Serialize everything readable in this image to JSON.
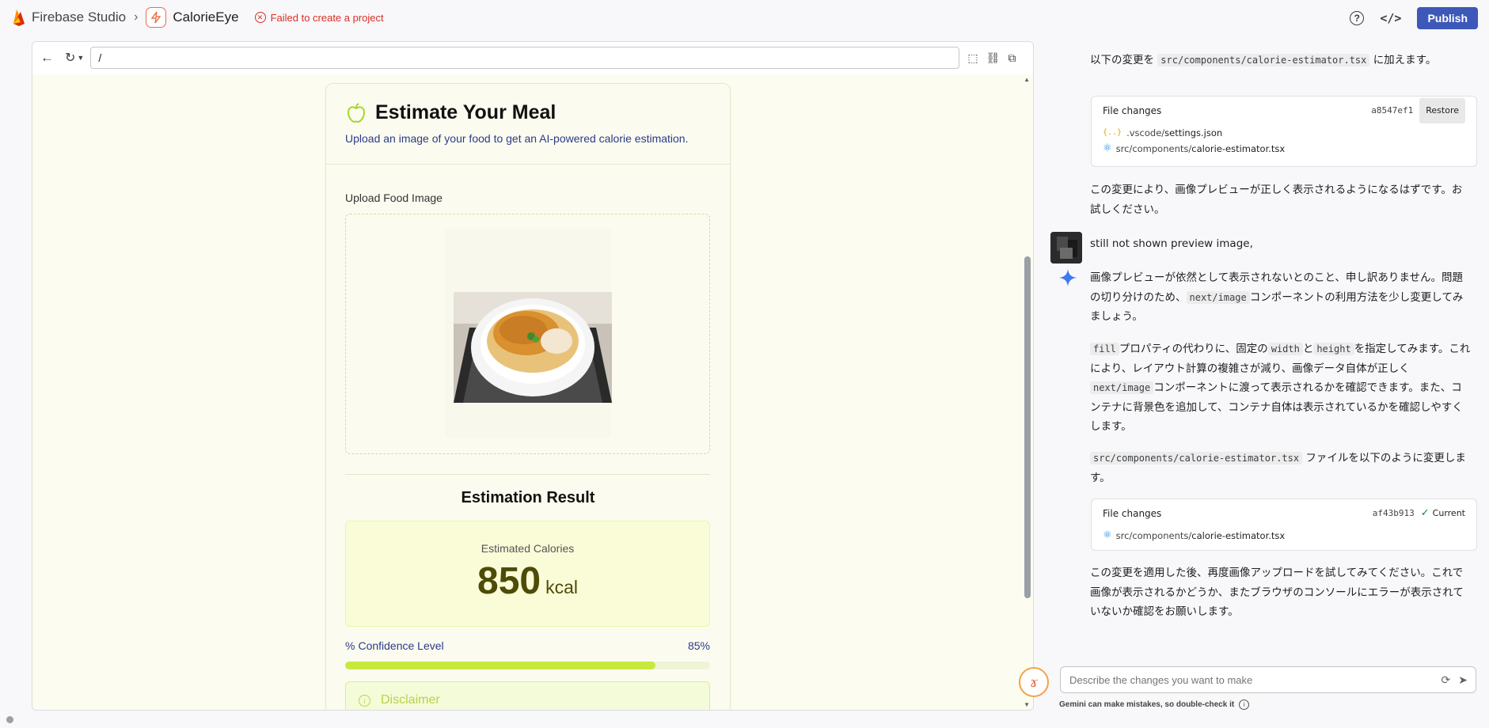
{
  "topbar": {
    "brand": "Firebase Studio",
    "project": "CalorieEye",
    "error": "Failed to create a project",
    "publish": "Publish"
  },
  "preview": {
    "url": "/",
    "card": {
      "title": "Estimate Your Meal",
      "subtitle": "Upload an image of your food to get an AI-powered calorie estimation.",
      "upload_label": "Upload Food Image",
      "result_title": "Estimation Result",
      "calorie_label": "Estimated Calories",
      "calorie_value": "850",
      "calorie_unit": "kcal",
      "confidence_label": "Confidence Level",
      "confidence_value": "85%",
      "confidence_fraction": 0.85,
      "disclaimer": "Disclaimer"
    }
  },
  "chat": {
    "m1_pre": "以下の変更を",
    "m1_code": "src/components/calorie-estimator.tsx",
    "m1_post": "に加えます。",
    "fc1": {
      "title": "File changes",
      "hash": "a8547ef1",
      "action": "Restore",
      "file1_dir": ".vscode/",
      "file1_name": "settings.json",
      "file2_dir": "src/components/",
      "file2_name": "calorie-estimator.tsx"
    },
    "m2": "この変更により、画像プレビューが正しく表示されるようになるはずです。お試しください。",
    "user_msg": "still not shown preview image,",
    "m3_a": "画像プレビューが依然として表示されないとのこと、申し訳ありません。問題の切り分けのため、",
    "m3_code": "next/image",
    "m3_b": "コンポーネントの利用方法を少し変更してみましょう。",
    "m4_code1": "fill",
    "m4_a": "プロパティの代わりに、固定の",
    "m4_code2": "width",
    "m4_b": "と",
    "m4_code3": "height",
    "m4_c": "を指定してみます。これにより、レイアウト計算の複雑さが減り、画像データ自体が正しく",
    "m4_code4": "next/image",
    "m4_d": "コンポーネントに渡って表示されるかを確認できます。また、コンテナに背景色を追加して、コンテナ自体は表示されているかを確認しやすくします。",
    "m5_code": "src/components/calorie-estimator.tsx",
    "m5_text": "ファイルを以下のように変更します。",
    "fc2": {
      "title": "File changes",
      "hash": "af43b913",
      "status": "Current",
      "file_dir": "src/components/",
      "file_name": "calorie-estimator.tsx"
    },
    "m6": "この変更を適用した後、再度画像アップロードを試してみてください。これで画像が表示されるかどうか、またブラウザのコンソールにエラーが表示されていないか確認をお願いします。"
  },
  "input": {
    "placeholder": "Describe the changes you want to make",
    "footnote": "Gemini can make mistakes, so double-check it"
  },
  "colors": {
    "accent": "#3c58b8",
    "error": "#d93025",
    "lime": "#c7e93d",
    "calorie": "#4e4b08"
  },
  "icons": [
    "firebase-logo-icon",
    "chevron-right-icon",
    "project-icon",
    "error-icon",
    "help-icon",
    "code-icon",
    "back-arrow-icon",
    "reload-icon",
    "inspect-icon",
    "link-icon",
    "open-external-icon",
    "apple-icon",
    "percent-icon",
    "info-icon",
    "json-file-icon",
    "react-icon",
    "check-icon",
    "gemini-sparkle-icon",
    "refresh-icon",
    "send-icon"
  ]
}
